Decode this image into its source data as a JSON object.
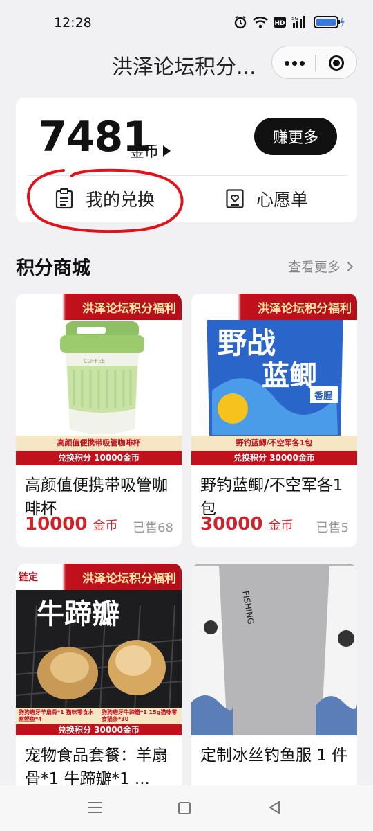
{
  "status_bar": {
    "time": "12:28"
  },
  "nav": {
    "title": "洪泽论坛积分..."
  },
  "account": {
    "coins": "7481",
    "coin_unit": "金币",
    "earn_more": "赚更多",
    "my_exchange": "我的兑换",
    "wishlist": "心愿单"
  },
  "section": {
    "title": "积分商城",
    "see_more": "查看更多"
  },
  "products": [
    {
      "ribbon": "洪泽论坛积分福利",
      "caption": "高颜值便携带吸管咖啡杯",
      "exchange_label": "兑换积分  10000金币",
      "image_brand": "COFFEE",
      "name": "高颜值便携带吸管咖啡杯",
      "price": "10000",
      "unit": "金币",
      "sold": "已售68"
    },
    {
      "ribbon": "洪泽论坛积分福利",
      "caption": "野钓蓝鲫/不空军各1包",
      "exchange_label": "兑换积分  30000金币",
      "image_text_top": "野战",
      "image_text_mid": "蓝鲫",
      "image_badge": "香腥",
      "name": "野钓蓝鲫/不空军各1包",
      "price": "30000",
      "unit": "金币",
      "sold": "已售5"
    },
    {
      "corner_tag": "链定",
      "ribbon": "洪泽论坛积分福利",
      "image_title": "牛蹄瓣",
      "caption_left": "狗狗磨牙羊扇骨*1 猫咪零食水煮鲣鱼*4",
      "caption_right": "狗狗磨牙牛蹄瓣*1 15g猫咪零食猫条*30",
      "exchange_label": "兑换积分  30000金币",
      "name": "宠物食品套餐：羊扇骨*1 牛蹄瓣*1 ..."
    },
    {
      "image_text": "FISHING",
      "name": "定制冰丝钓鱼服 1 件"
    }
  ],
  "colors": {
    "accent_red": "#d0222b",
    "ribbon_red": "#c0111d",
    "bg": "#f1f1f3"
  }
}
